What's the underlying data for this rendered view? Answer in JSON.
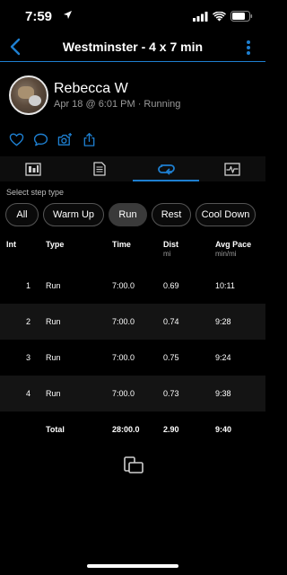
{
  "status_bar": {
    "time": "7:59"
  },
  "nav": {
    "title": "Westminster - 4 x 7 min"
  },
  "profile": {
    "name": "Rebecca W",
    "meta": "Apr 18 @ 6:01 PM · Running"
  },
  "filter": {
    "label": "Select step type",
    "chips": [
      "All",
      "Warm Up",
      "Run",
      "Rest",
      "Cool Down"
    ],
    "selected": "Run"
  },
  "table": {
    "headers": {
      "int": "Int",
      "type": "Type",
      "time": "Time",
      "dist": "Dist",
      "dist_unit": "mi",
      "pace": "Avg Pace",
      "pace_unit": "min/mi"
    },
    "rows": [
      {
        "int": "1",
        "type": "Run",
        "time": "7:00.0",
        "dist": "0.69",
        "pace": "10:11"
      },
      {
        "int": "2",
        "type": "Run",
        "time": "7:00.0",
        "dist": "0.74",
        "pace": "9:28"
      },
      {
        "int": "3",
        "type": "Run",
        "time": "7:00.0",
        "dist": "0.75",
        "pace": "9:24"
      },
      {
        "int": "4",
        "type": "Run",
        "time": "7:00.0",
        "dist": "0.73",
        "pace": "9:38"
      }
    ],
    "total": {
      "type": "Total",
      "time": "28:00.0",
      "dist": "2.90",
      "pace": "9:40"
    }
  },
  "colors": {
    "accent": "#1e7fd0",
    "background": "#000000",
    "row_alt": "#141414"
  }
}
